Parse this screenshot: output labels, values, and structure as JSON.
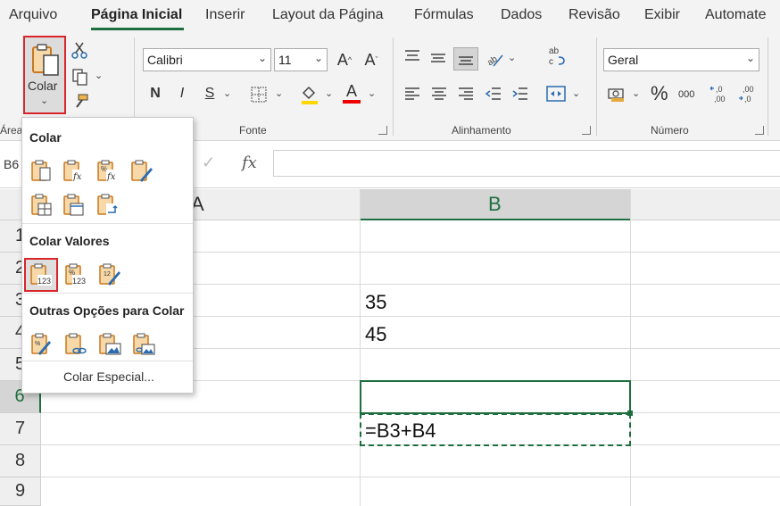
{
  "tabs": [
    "Arquivo",
    "Página Inicial",
    "Inserir",
    "Layout da Página",
    "Fórmulas",
    "Dados",
    "Revisão",
    "Exibir",
    "Automate"
  ],
  "clipboard": {
    "paste_label": "Colar",
    "group_label_partial": "Área"
  },
  "font": {
    "name": "Calibri",
    "size": "11",
    "bold": "N",
    "italic": "I",
    "underline": "S",
    "group_label": "Fonte"
  },
  "alignment": {
    "group_label": "Alinhamento"
  },
  "number": {
    "format": "Geral",
    "percent": "%",
    "thousands": "000",
    "group_label": "Número"
  },
  "formula_bar": {
    "name_box_partial": "B6",
    "fx": "fx",
    "content": ""
  },
  "columns": [
    "A",
    "B"
  ],
  "rows": [
    "1",
    "2",
    "3",
    "4",
    "5",
    "6",
    "7",
    "8",
    "9"
  ],
  "cells": {
    "B3": "35",
    "B4": "45",
    "B7": "=B3+B4"
  },
  "paste_menu": {
    "section_paste": "Colar",
    "section_values": "Colar Valores",
    "section_other": "Outras Opções para Colar",
    "special": "Colar Especial..."
  },
  "colors": {
    "accent": "#1e6f3f",
    "highlight": "#d9262c",
    "clipboard": "#c9781f"
  }
}
